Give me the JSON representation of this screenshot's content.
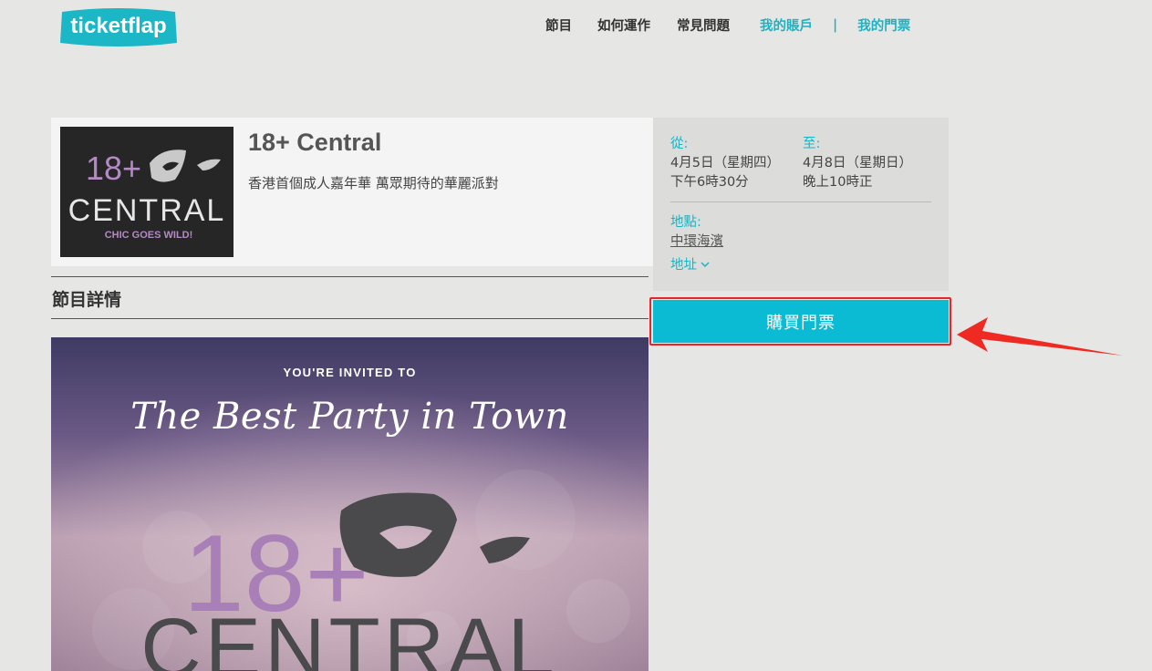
{
  "brand": {
    "logo_text": "ticketflap"
  },
  "nav": {
    "programs": "節目",
    "how_it_works": "如何運作",
    "faq": "常見問題",
    "my_account": "我的賬戶",
    "separator": "|",
    "my_tickets": "我的門票"
  },
  "event": {
    "title": "18+ Central",
    "subtitle": "香港首個成人嘉年華 萬眾期待的華麗派對",
    "thumbnail": {
      "line1": "18+",
      "line2": "CENTRAL",
      "tagline": "CHIC GOES WILD!"
    }
  },
  "info": {
    "from_label": "從:",
    "from_date": "4月5日（星期四）",
    "from_time": "下午6時30分",
    "to_label": "至:",
    "to_date": "4月8日（星期日）",
    "to_time": "晚上10時正",
    "venue_label": "地點:",
    "venue_name": "中環海濱",
    "address_toggle": "地址"
  },
  "buy_button_label": "購買門票",
  "details_heading": "節目詳情",
  "poster": {
    "invite_text": "YOU'RE INVITED TO",
    "headline": "The Best Party in Town",
    "logo_line1": "18+",
    "logo_line2": "CENTRAL"
  },
  "colors": {
    "accent_teal": "#1ab3c4",
    "button_teal": "#0bbbd3",
    "highlight_red": "#e8262a",
    "page_bg": "#e6e6e4"
  },
  "icons": {
    "logo": "ticketflap-logo",
    "address_chevron": "chevron-down-icon",
    "annotation_arrow": "red-arrow-icon",
    "mask": "mask-icon"
  }
}
